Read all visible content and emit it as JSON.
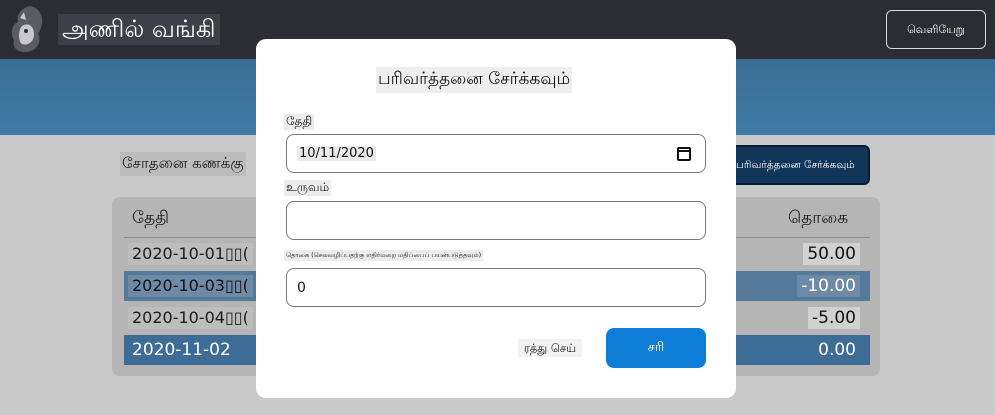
{
  "header": {
    "brand": "அணில் வங்கி",
    "logout_label": "வெளியேறு"
  },
  "account": {
    "title": "சோதனை கணக்கு",
    "add_transaction_label": "பரிவர்த்தனை சேர்க்கவும்"
  },
  "table": {
    "headers": {
      "date": "தேதி",
      "amount": "தொகை"
    },
    "rows": [
      {
        "date": "2020-10-01▯▯(",
        "amount": "50.00"
      },
      {
        "date": "2020-10-03▯▯(",
        "amount": "-10.00"
      },
      {
        "date": "2020-10-04▯▯(",
        "amount": "-5.00"
      },
      {
        "date": "2020-11-02",
        "amount": "0.00"
      }
    ]
  },
  "modal": {
    "title": "பரிவர்த்தனை சேர்க்கவும்",
    "date_label": "தேதி",
    "date_value": "10/11/2020",
    "object_label": "உருவம்",
    "object_value": "",
    "amount_label": "தொகை (செலவழிப்பதற்கு எதிர்மறை மதிப்பைப் பயன்படுத்தவும்)",
    "amount_value": "0",
    "cancel_label": "ரத்து செய்",
    "ok_label": "சரி"
  },
  "colors": {
    "header_bg": "#2b2c34",
    "banner": "#3f7ba6",
    "primary_button": "#0e7dd8",
    "overlay": "#c9c9c9"
  }
}
